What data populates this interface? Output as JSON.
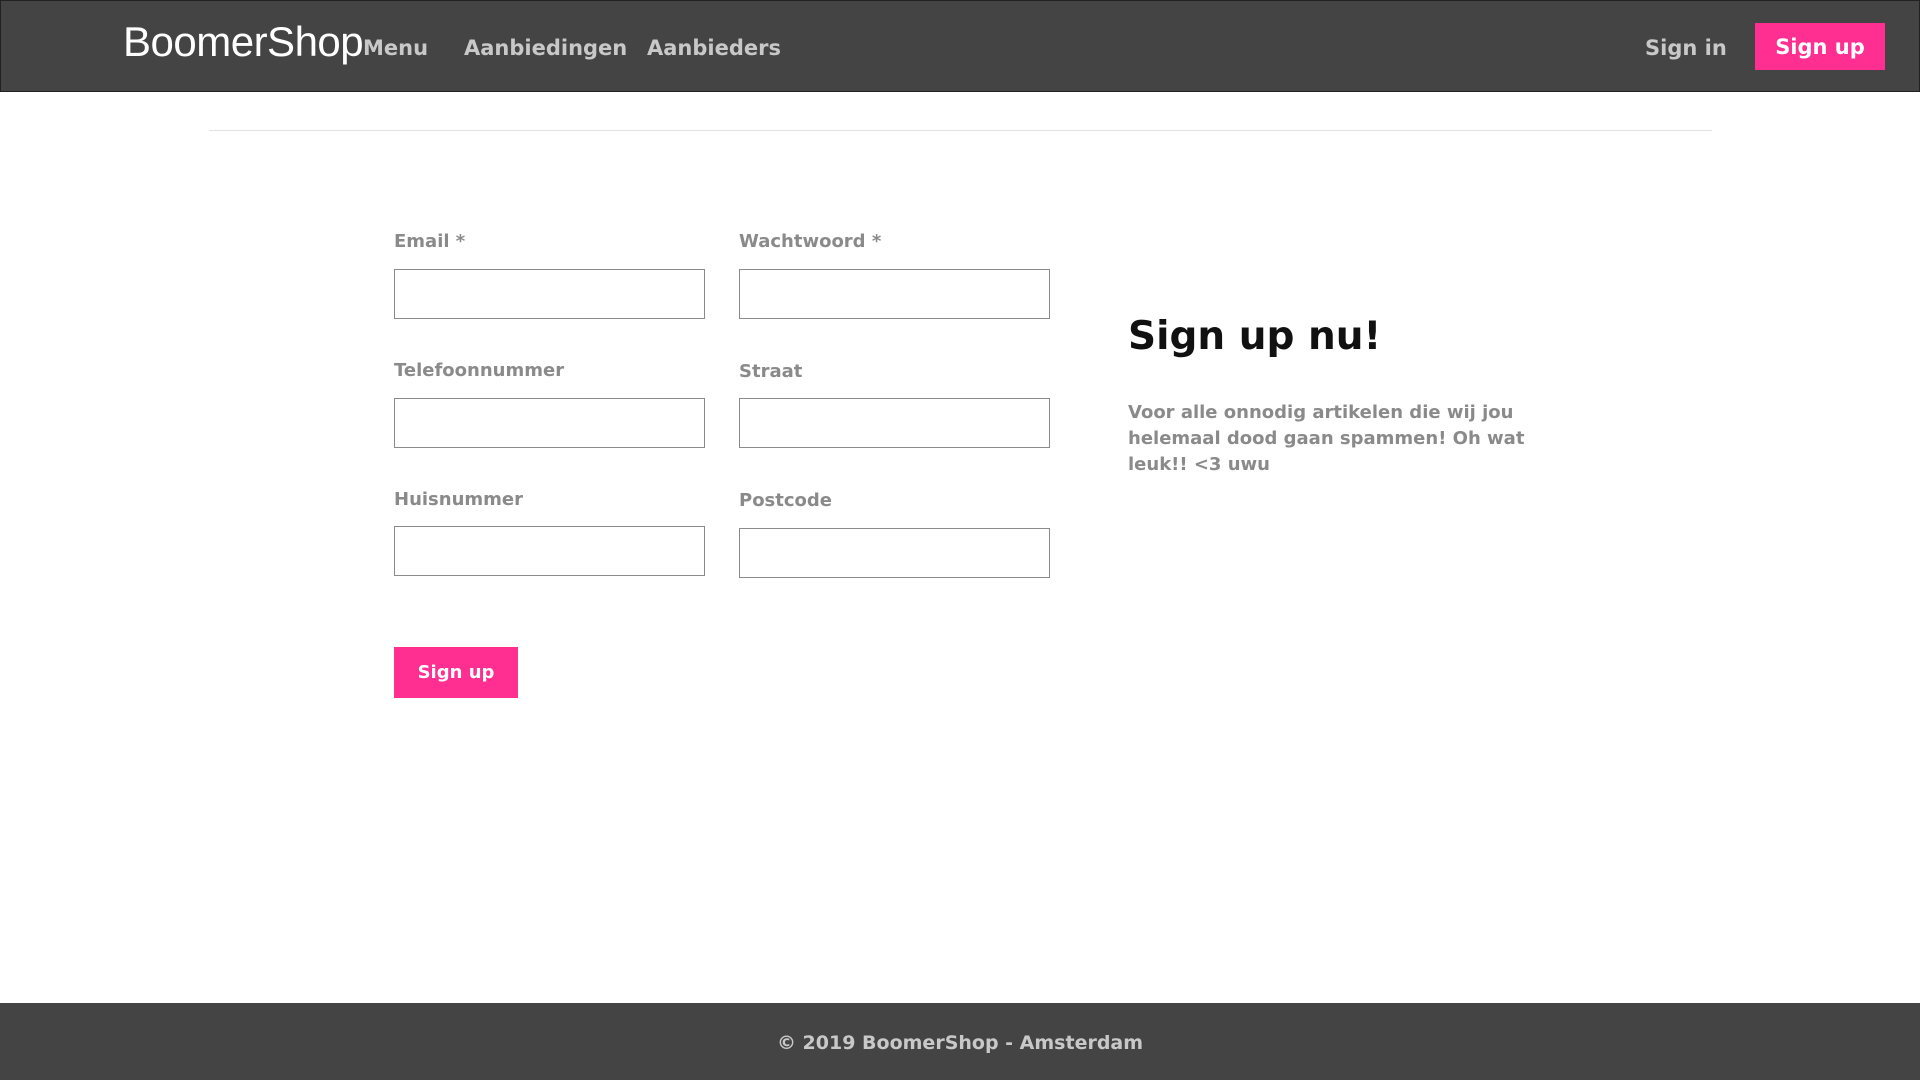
{
  "colors": {
    "navbar_bg": "#444444",
    "accent": "#ff2f92",
    "nav_text": "#c8c8c8",
    "label_text": "#8a8a8a",
    "footer_bg": "#444444"
  },
  "navbar": {
    "brand": "BoomerShop",
    "links": [
      "Menu",
      "Aanbiedingen",
      "Aanbieders"
    ],
    "sign_in": "Sign in",
    "sign_up": "Sign up"
  },
  "form": {
    "fields": [
      {
        "label": "Email *",
        "value": "",
        "placeholder": ""
      },
      {
        "label": "Wachtwoord *",
        "value": "",
        "placeholder": ""
      },
      {
        "label": "Telefoonnummer",
        "value": "",
        "placeholder": ""
      },
      {
        "label": "Straat",
        "value": "",
        "placeholder": ""
      },
      {
        "label": "Huisnummer",
        "value": "",
        "placeholder": ""
      },
      {
        "label": "Postcode",
        "value": "",
        "placeholder": ""
      }
    ],
    "submit": "Sign up"
  },
  "side": {
    "title": "Sign up nu!",
    "text": "Voor alle onnodig artikelen die wij jou helemaal dood gaan spammen! Oh wat leuk!! <3 uwu"
  },
  "footer": {
    "text": "© 2019 BoomerShop - Amsterdam"
  }
}
